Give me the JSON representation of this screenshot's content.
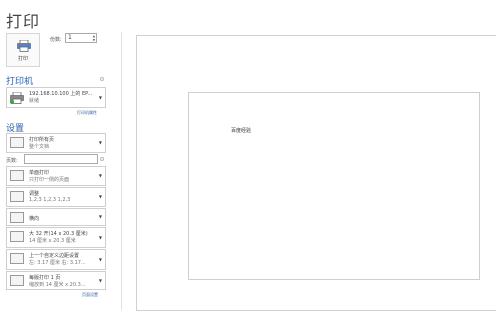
{
  "window_title": "打印",
  "print_button": {
    "label": "打印",
    "icon": "printer-icon"
  },
  "copies": {
    "label": "份数:",
    "value": "1"
  },
  "printer_section": {
    "heading": "打印机",
    "printer": {
      "name": "192.168.10.100 上的 EP...",
      "status": "就绪",
      "icon": "printer-icon"
    },
    "properties_link": "打印机属性"
  },
  "settings_section": {
    "heading": "设置",
    "scope": {
      "line1": "打印所有页",
      "line2": "整个文档"
    },
    "pages": {
      "label": "页数:",
      "value": ""
    },
    "sides": {
      "line1": "单面打印",
      "line2": "只打印一侧的页面"
    },
    "collate": {
      "line1": "调整",
      "line2": "1,2,3    1,2,3    1,2,3"
    },
    "orientation": {
      "line1": "横向"
    },
    "paper_size": {
      "line1": "大 32 开(14 x 20.3 厘米)",
      "line2": "14 厘米 x 20.3 厘米"
    },
    "margins": {
      "line1": "上一个自定义边距设置",
      "line2": "左: 3.17 厘米    右: 3.17..."
    },
    "pages_per_sheet": {
      "line1": "每版打印 1 页",
      "line2": "缩放到 14 厘米 x 20.3..."
    },
    "page_setup_link": "页面设置"
  },
  "preview": {
    "text": "百度经验"
  }
}
